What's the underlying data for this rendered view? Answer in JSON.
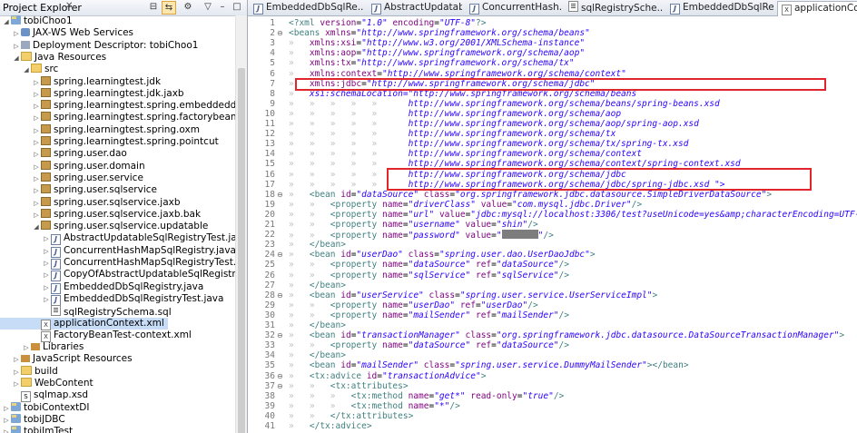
{
  "explorer": {
    "title": "Project Explorer",
    "tree": [
      {
        "label": "tobiChoo1",
        "icon": "project",
        "depth": 0,
        "exp": "down"
      },
      {
        "label": "JAX-WS Web Services",
        "icon": "ws",
        "depth": 1,
        "exp": "right"
      },
      {
        "label": "Deployment Descriptor: tobiChoo1",
        "icon": "dd",
        "depth": 1,
        "exp": "right"
      },
      {
        "label": "Java Resources",
        "icon": "folder",
        "depth": 1,
        "exp": "down"
      },
      {
        "label": "src",
        "icon": "src",
        "depth": 2,
        "exp": "down"
      },
      {
        "label": "spring.learningtest.jdk",
        "icon": "pkg",
        "depth": 3,
        "exp": "right"
      },
      {
        "label": "spring.learningtest.jdk.jaxb",
        "icon": "pkg",
        "depth": 3,
        "exp": "right"
      },
      {
        "label": "spring.learningtest.spring.embeddeddb",
        "icon": "pkg",
        "depth": 3,
        "exp": "right"
      },
      {
        "label": "spring.learningtest.spring.factorybean",
        "icon": "pkg",
        "depth": 3,
        "exp": "right"
      },
      {
        "label": "spring.learningtest.spring.oxm",
        "icon": "pkg",
        "depth": 3,
        "exp": "right"
      },
      {
        "label": "spring.learningtest.spring.pointcut",
        "icon": "pkg",
        "depth": 3,
        "exp": "right"
      },
      {
        "label": "spring.user.dao",
        "icon": "pkg",
        "depth": 3,
        "exp": "right"
      },
      {
        "label": "spring.user.domain",
        "icon": "pkg",
        "depth": 3,
        "exp": "right"
      },
      {
        "label": "spring.user.service",
        "icon": "pkg",
        "depth": 3,
        "exp": "right"
      },
      {
        "label": "spring.user.sqlservice",
        "icon": "pkg",
        "depth": 3,
        "exp": "right"
      },
      {
        "label": "spring.user.sqlservice.jaxb",
        "icon": "pkg",
        "depth": 3,
        "exp": "right"
      },
      {
        "label": "spring.user.sqlservice.jaxb.bak",
        "icon": "pkg",
        "depth": 3,
        "exp": "right"
      },
      {
        "label": "spring.user.sqlservice.updatable",
        "icon": "pkg",
        "depth": 3,
        "exp": "down"
      },
      {
        "label": "AbstractUpdatableSqlRegistryTest.java",
        "icon": "java",
        "depth": 4,
        "exp": "right"
      },
      {
        "label": "ConcurrentHashMapSqlRegistry.java",
        "icon": "java",
        "depth": 4,
        "exp": "right"
      },
      {
        "label": "ConcurrentHashMapSqlRegistryTest.java",
        "icon": "java",
        "depth": 4,
        "exp": "right"
      },
      {
        "label": "CopyOfAbstractUpdatableSqlRegistryTest.java",
        "icon": "java",
        "depth": 4,
        "exp": "right"
      },
      {
        "label": "EmbeddedDbSqlRegistry.java",
        "icon": "java",
        "depth": 4,
        "exp": "right"
      },
      {
        "label": "EmbeddedDbSqlRegistryTest.java",
        "icon": "java",
        "depth": 4,
        "exp": "right"
      },
      {
        "label": "sqlRegistrySchema.sql",
        "icon": "sql",
        "depth": 4,
        "exp": ""
      },
      {
        "label": "applicationContext.xml",
        "icon": "xml",
        "depth": 3,
        "exp": ""
      },
      {
        "label": "FactoryBeanTest-context.xml",
        "icon": "xml",
        "depth": 3,
        "exp": ""
      },
      {
        "label": "Libraries",
        "icon": "lib",
        "depth": 2,
        "exp": "right"
      },
      {
        "label": "JavaScript Resources",
        "icon": "lib",
        "depth": 1,
        "exp": "right"
      },
      {
        "label": "build",
        "icon": "folder",
        "depth": 1,
        "exp": "right"
      },
      {
        "label": "WebContent",
        "icon": "folder",
        "depth": 1,
        "exp": "right"
      },
      {
        "label": "sqlmap.xsd",
        "icon": "s",
        "depth": 1,
        "exp": ""
      },
      {
        "label": "tobiContextDI",
        "icon": "project",
        "depth": 0,
        "exp": "right"
      },
      {
        "label": "tobiJDBC",
        "icon": "project",
        "depth": 0,
        "exp": "right"
      },
      {
        "label": "tobiJmTest",
        "icon": "project",
        "depth": 0,
        "exp": "right"
      }
    ]
  },
  "tabs": [
    {
      "label": "EmbeddedDbSqlRe...",
      "icon": "java"
    },
    {
      "label": "AbstractUpdatabl...",
      "icon": "java"
    },
    {
      "label": "ConcurrentHash...",
      "icon": "java"
    },
    {
      "label": "sqlRegistrySche...",
      "icon": "sql"
    },
    {
      "label": "EmbeddedDbSqlRe...",
      "icon": "java"
    },
    {
      "label": "applicationCont...",
      "icon": "xml"
    }
  ],
  "code": [
    {
      "n": "1",
      "f": "",
      "t": "<?xml version=\"1.0\" encoding=\"UTF-8\"?>"
    },
    {
      "n": "2",
      "f": "⊖",
      "t": "<beans xmlns=\"http://www.springframework.org/schema/beans\""
    },
    {
      "n": "3",
      "f": "",
      "t": "    xmlns:xsi=\"http://www.w3.org/2001/XMLSchema-instance\""
    },
    {
      "n": "4",
      "f": "",
      "t": "    xmlns:aop=\"http://www.springframework.org/schema/aop\""
    },
    {
      "n": "5",
      "f": "",
      "t": "    xmlns:tx=\"http://www.springframework.org/schema/tx\""
    },
    {
      "n": "6",
      "f": "",
      "t": "    xmlns:context=\"http://www.springframework.org/schema/context\""
    },
    {
      "n": "7",
      "f": "",
      "t": "    xmlns:jdbc=\"http://www.springframework.org/schema/jdbc\""
    },
    {
      "n": "8",
      "f": "",
      "t": "    xsi:schemaLocation=\"http://www.springframework.org/schema/beans"
    },
    {
      "n": "9",
      "f": "",
      "t": "                       http://www.springframework.org/schema/beans/spring-beans.xsd"
    },
    {
      "n": "10",
      "f": "",
      "t": "                       http://www.springframework.org/schema/aop"
    },
    {
      "n": "11",
      "f": "",
      "t": "                       http://www.springframework.org/schema/aop/spring-aop.xsd"
    },
    {
      "n": "12",
      "f": "",
      "t": "                       http://www.springframework.org/schema/tx"
    },
    {
      "n": "13",
      "f": "",
      "t": "                       http://www.springframework.org/schema/tx/spring-tx.xsd"
    },
    {
      "n": "14",
      "f": "",
      "t": "                       http://www.springframework.org/schema/context"
    },
    {
      "n": "15",
      "f": "",
      "t": "                       http://www.springframework.org/schema/context/spring-context.xsd"
    },
    {
      "n": "16",
      "f": "",
      "t": "                       http://www.springframework.org/schema/jdbc"
    },
    {
      "n": "17",
      "f": "",
      "t": "                       http://www.springframework.org/schema/jdbc/spring-jdbc.xsd \">"
    },
    {
      "n": "18",
      "f": "⊖",
      "t": "    <bean id=\"dataSource\" class=\"org.springframework.jdbc.datasource.SimpleDriverDataSource\">"
    },
    {
      "n": "19",
      "f": "",
      "t": "        <property name=\"driverClass\" value=\"com.mysql.jdbc.Driver\"/>"
    },
    {
      "n": "20",
      "f": "",
      "t": "        <property name=\"url\" value=\"jdbc:mysql://localhost:3306/test?useUnicode=yes&amp;characterEncoding=UTF-8\"/>"
    },
    {
      "n": "21",
      "f": "",
      "t": "        <property name=\"username\" value=\"shin\"/>"
    },
    {
      "n": "22",
      "f": "",
      "t": "        <property name=\"password\" value=\"MASK\"/>"
    },
    {
      "n": "23",
      "f": "",
      "t": "    </bean>"
    },
    {
      "n": "24",
      "f": "⊖",
      "t": "    <bean id=\"userDao\" class=\"spring.user.dao.UserDaoJdbc\">"
    },
    {
      "n": "25",
      "f": "",
      "t": "        <property name=\"dataSource\" ref=\"dataSource\"/>"
    },
    {
      "n": "26",
      "f": "",
      "t": "        <property name=\"sqlService\" ref=\"sqlService\"/>"
    },
    {
      "n": "27",
      "f": "",
      "t": "    </bean>"
    },
    {
      "n": "28",
      "f": "⊖",
      "t": "    <bean id=\"userService\" class=\"spring.user.service.UserServiceImpl\">"
    },
    {
      "n": "29",
      "f": "",
      "t": "        <property name=\"userDao\" ref=\"userDao\"/>"
    },
    {
      "n": "30",
      "f": "",
      "t": "        <property name=\"mailSender\" ref=\"mailSender\"/>"
    },
    {
      "n": "31",
      "f": "",
      "t": "    </bean>"
    },
    {
      "n": "32",
      "f": "⊖",
      "t": "    <bean id=\"transactionManager\" class=\"org.springframework.jdbc.datasource.DataSourceTransactionManager\">"
    },
    {
      "n": "33",
      "f": "",
      "t": "        <property name=\"dataSource\" ref=\"dataSource\"/>"
    },
    {
      "n": "34",
      "f": "",
      "t": "    </bean>"
    },
    {
      "n": "35",
      "f": "",
      "t": "    <bean id=\"mailSender\" class=\"spring.user.service.DummyMailSender\"></bean>"
    },
    {
      "n": "36",
      "f": "⊖",
      "t": "    <tx:advice id=\"transactionAdvice\">"
    },
    {
      "n": "37",
      "f": "⊖",
      "t": "        <tx:attributes>"
    },
    {
      "n": "38",
      "f": "",
      "t": "            <tx:method name=\"get*\" read-only=\"true\"/>"
    },
    {
      "n": "39",
      "f": "",
      "t": "            <tx:method name=\"*\"/>"
    },
    {
      "n": "40",
      "f": "",
      "t": "        </tx:attributes>"
    },
    {
      "n": "41",
      "f": "",
      "t": "    </tx:advice>"
    }
  ],
  "colors": {
    "tag": "#3f7f7f",
    "attr": "#7f007f",
    "value": "#2a00ff",
    "highlight": "#e0262c",
    "selection": "#c7dcf7"
  }
}
